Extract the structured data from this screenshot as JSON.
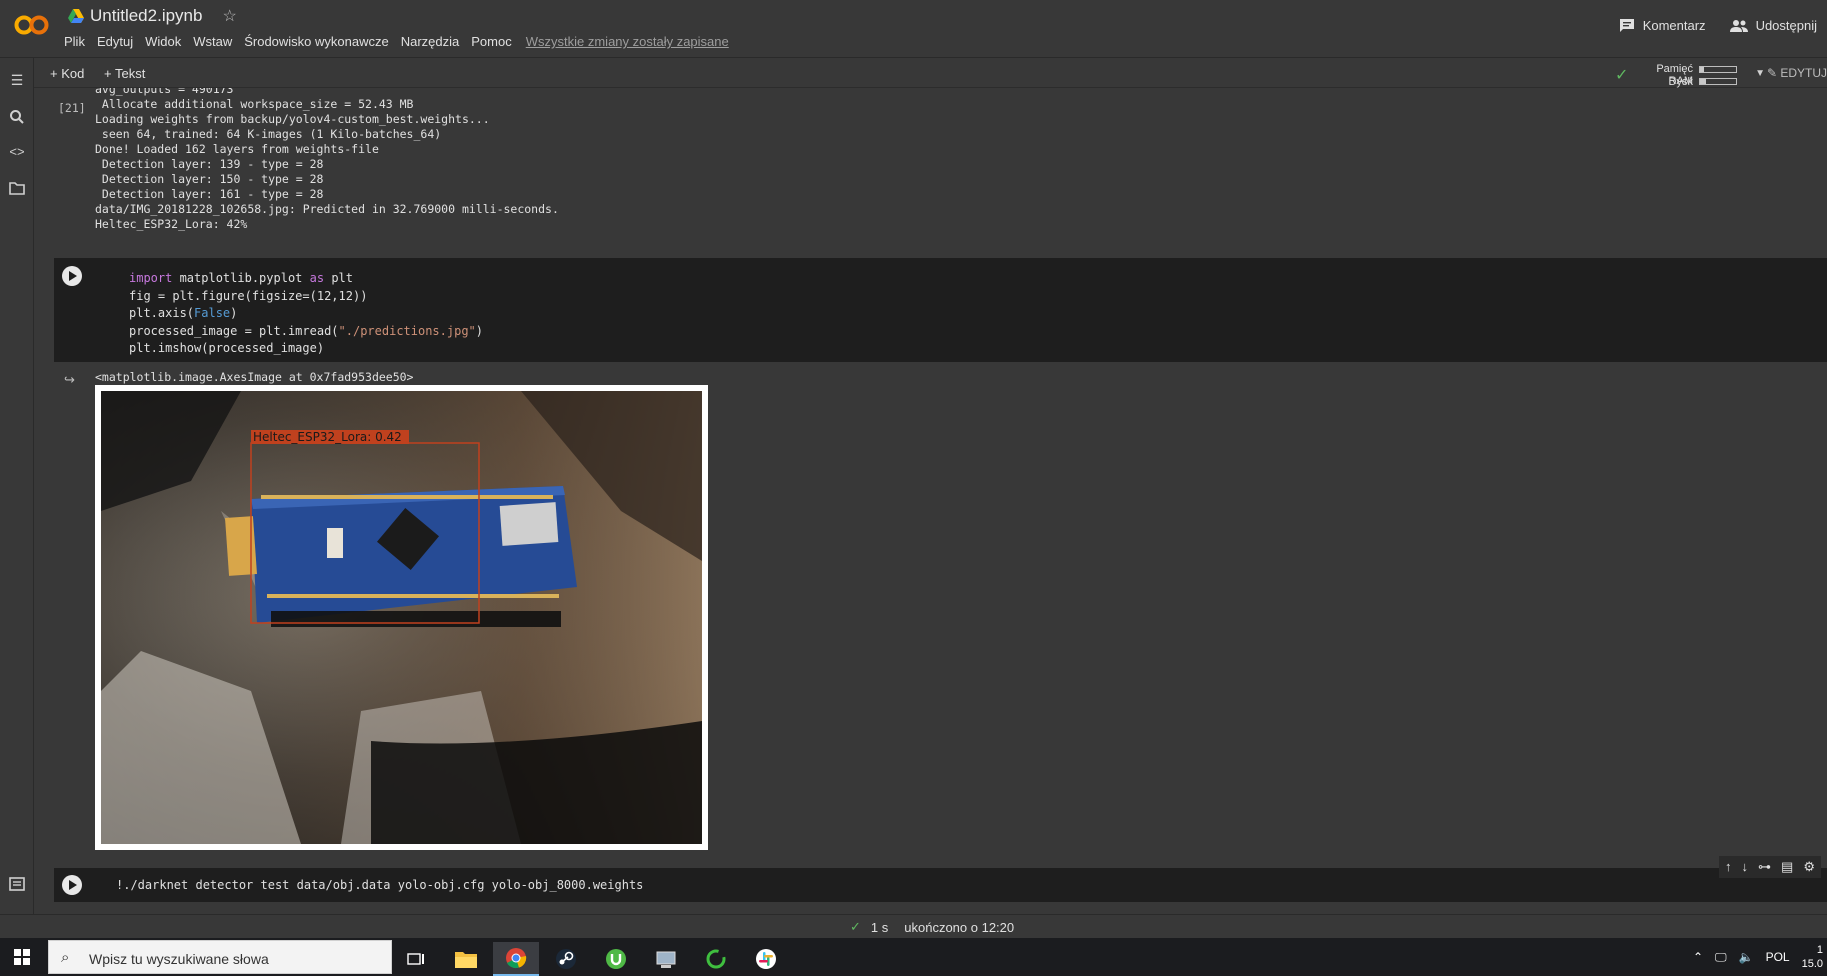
{
  "header": {
    "doc_title": "Untitled2.ipynb",
    "menu": [
      "Plik",
      "Edytuj",
      "Widok",
      "Wstaw",
      "Środowisko wykonawcze",
      "Narzędzia",
      "Pomoc"
    ],
    "saved_status": "Wszystkie zmiany zostały zapisane",
    "comment_label": "Komentarz",
    "share_label": "Udostępnij"
  },
  "toolbar": {
    "add_code": "Kod",
    "add_text": "Tekst",
    "ram_label": "Pamięć RAM",
    "disk_label": "Dysk",
    "ram_fraction": 0.12,
    "disk_fraction": 0.18,
    "edit_label": "EDYTUJ"
  },
  "cell_output_1": {
    "exec_count": "[21]",
    "text": "avg_outputs = 490173\n Allocate additional workspace_size = 52.43 MB\nLoading weights from backup/yolov4-custom_best.weights...\n seen 64, trained: 64 K-images (1 Kilo-batches_64)\nDone! Loaded 162 layers from weights-file\n Detection layer: 139 - type = 28\n Detection layer: 150 - type = 28\n Detection layer: 161 - type = 28\ndata/IMG_20181228_102658.jpg: Predicted in 32.769000 milli-seconds.\nHeltec_ESP32_Lora: 42%"
  },
  "code_cell": {
    "lines": [
      {
        "parts": [
          {
            "t": "import",
            "c": "kw"
          },
          {
            "t": " matplotlib.pyplot ",
            "c": ""
          },
          {
            "t": "as",
            "c": "kw"
          },
          {
            "t": " plt",
            "c": ""
          }
        ]
      },
      {
        "parts": [
          {
            "t": "fig = plt.figure(figsize=(12,12))",
            "c": ""
          }
        ]
      },
      {
        "parts": [
          {
            "t": "plt.axis(",
            "c": ""
          },
          {
            "t": "False",
            "c": "kwb"
          },
          {
            "t": ")",
            "c": ""
          }
        ]
      },
      {
        "parts": [
          {
            "t": "processed_image = plt.imread(",
            "c": ""
          },
          {
            "t": "\"./predictions.jpg\"",
            "c": "str"
          },
          {
            "t": ")",
            "c": ""
          }
        ]
      },
      {
        "parts": [
          {
            "t": "plt.imshow(processed_image)",
            "c": ""
          }
        ]
      }
    ]
  },
  "cell_output_2": {
    "repr": "<matplotlib.image.AxesImage at 0x7fad953dee50>",
    "detection_label": "Heltec_ESP32_Lora: 0.42"
  },
  "code_cell_2": {
    "text": "!./darknet detector test data/obj.data yolo-obj.cfg yolo-obj_8000.weights"
  },
  "status": {
    "duration": "1 s",
    "completed": "ukończono o 12:20"
  },
  "taskbar": {
    "search_placeholder": "Wpisz tu wyszukiwane słowa",
    "language": "POL",
    "time": "1",
    "date": "15.0"
  }
}
